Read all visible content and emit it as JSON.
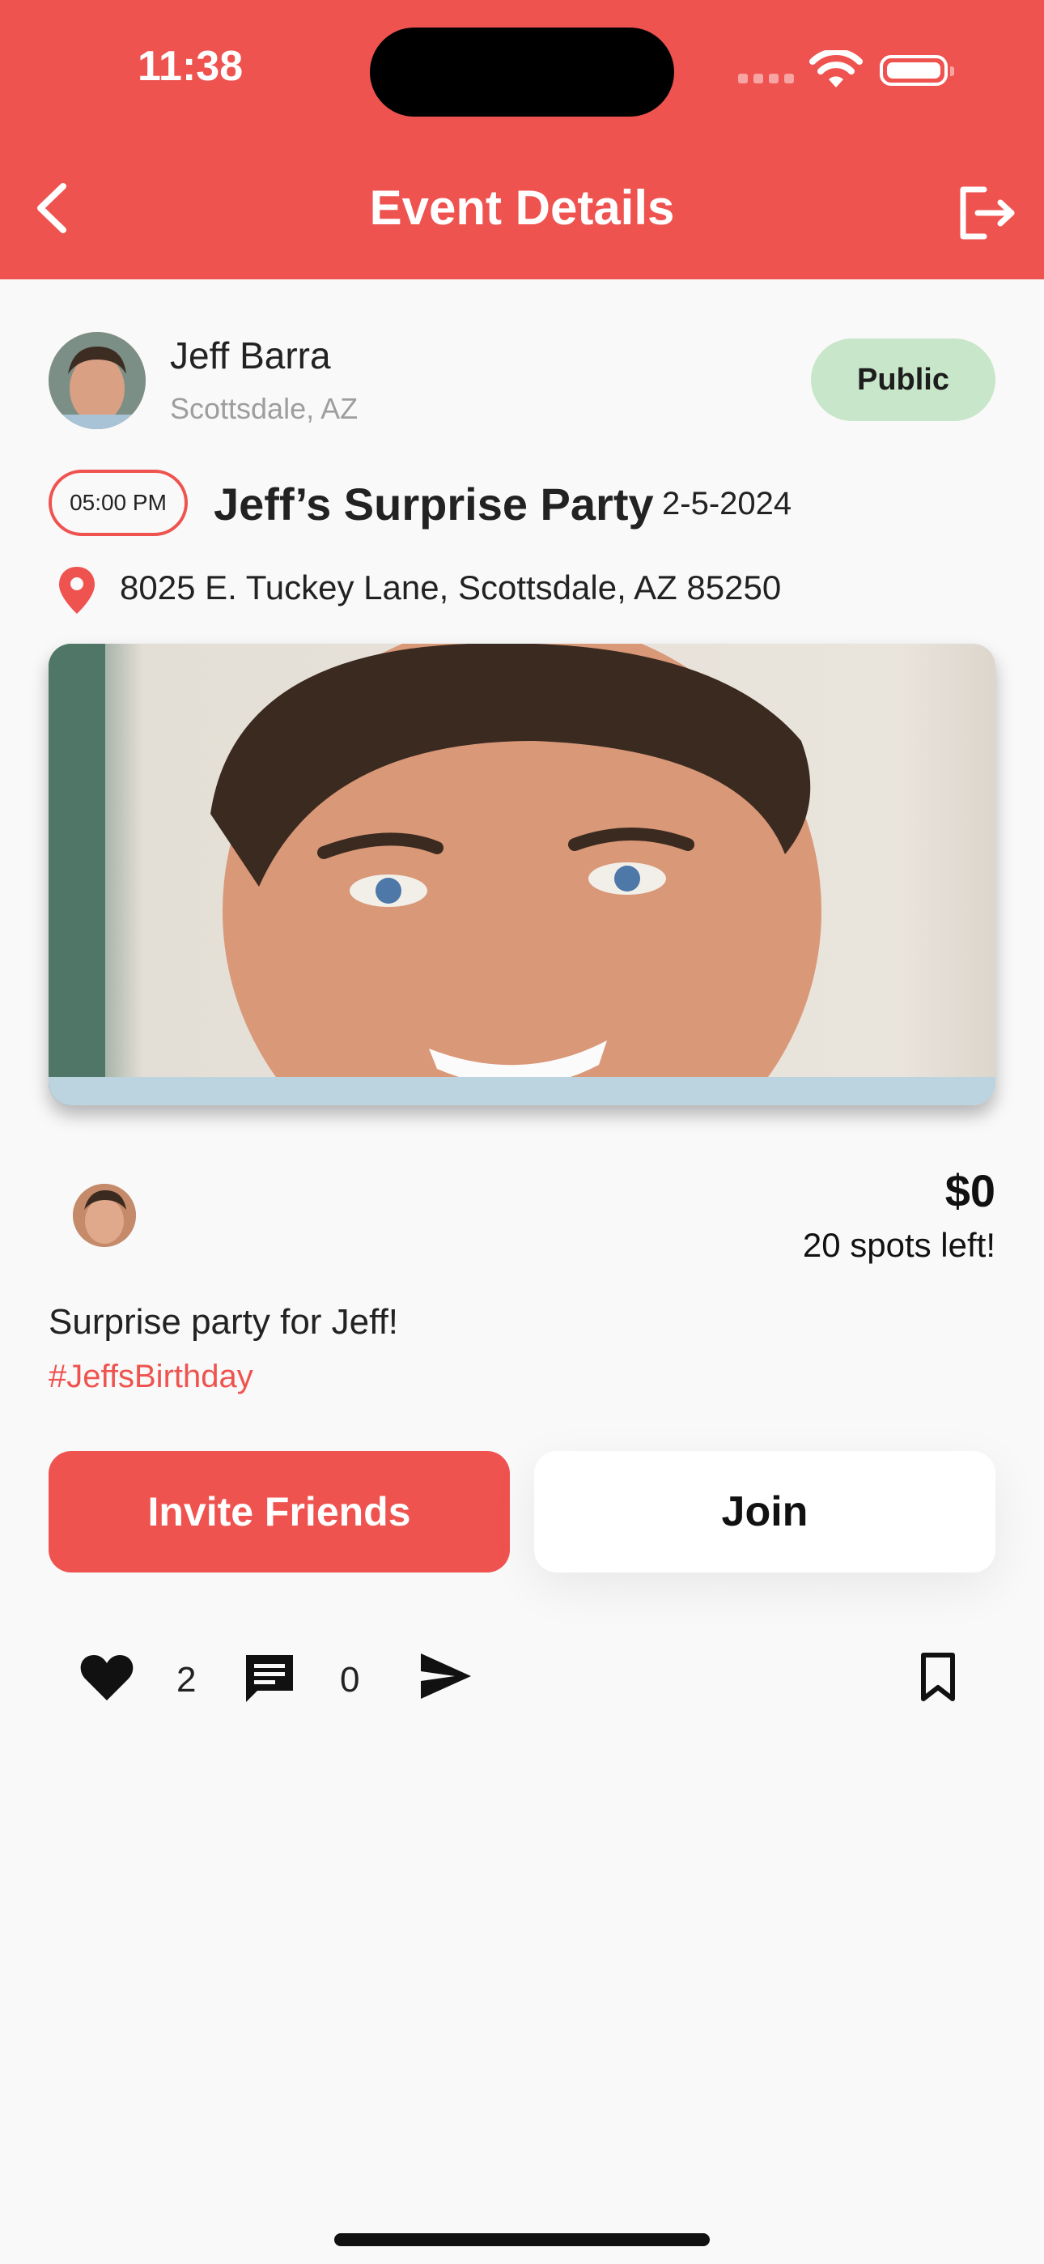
{
  "status_bar": {
    "time": "11:38"
  },
  "header": {
    "title": "Event Details"
  },
  "host": {
    "name": "Jeff Barra",
    "location": "Scottsdale, AZ",
    "visibility": "Public"
  },
  "event": {
    "time": "05:00 PM",
    "title": "Jeff’s Surprise Party",
    "date": "2-5-2024",
    "address": "8025 E. Tuckey Lane, Scottsdale, AZ 85250",
    "price": "$0",
    "spots": "20 spots left!",
    "description": "Surprise party for Jeff!",
    "hashtag": "#JeffsBirthday"
  },
  "actions": {
    "invite_label": "Invite Friends",
    "join_label": "Join"
  },
  "engagement": {
    "likes": "2",
    "comments": "0"
  },
  "colors": {
    "accent": "#ef5350",
    "public_badge": "#c8e6c9",
    "background": "#f9f9f9"
  },
  "icons": [
    "back-icon",
    "logout-icon",
    "location-pin-icon",
    "heart-icon",
    "comment-icon",
    "share-icon",
    "bookmark-icon",
    "wifi-icon",
    "battery-icon"
  ]
}
